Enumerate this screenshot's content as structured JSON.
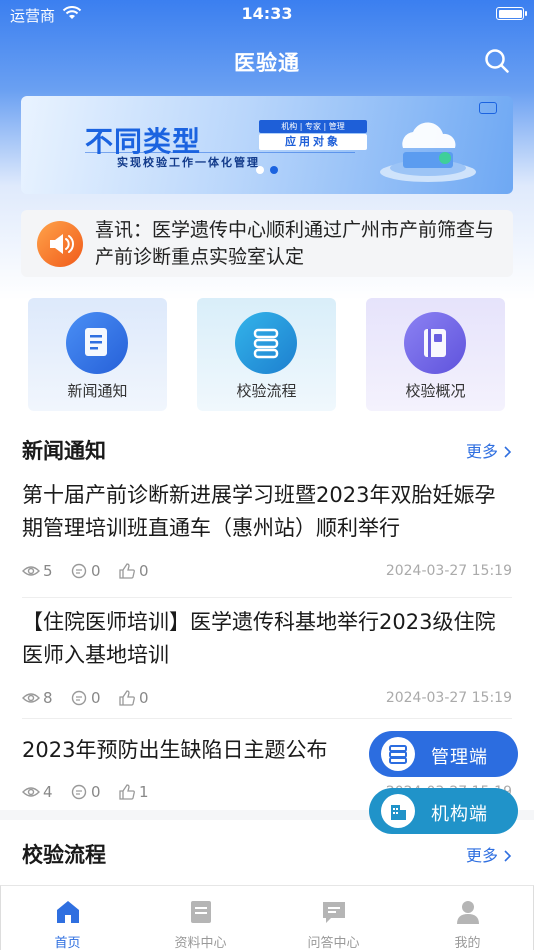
{
  "status_bar": {
    "carrier": "运营商",
    "time": "14:33"
  },
  "nav": {
    "title": "医验通"
  },
  "banner": {
    "title": "不同类型",
    "tags": "机构 | 专家 | 管理",
    "badge": "应用对象",
    "subtitle": "实现校验工作一体化管理",
    "active_index": 0,
    "dot_count": 2
  },
  "notice": {
    "text": "喜讯：医学遗传中心顺利通过广州市产前筛查与产前诊断重点实验室认定"
  },
  "quick_entries": [
    {
      "label": "新闻通知",
      "icon": "document-icon"
    },
    {
      "label": "校验流程",
      "icon": "flow-icon"
    },
    {
      "label": "校验概况",
      "icon": "book-icon"
    }
  ],
  "news_section": {
    "title": "新闻通知",
    "more": "更多",
    "items": [
      {
        "title": "第十届产前诊断新进展学习班暨2023年双胎妊娠孕期管理培训班直通车（惠州站）顺利举行",
        "views": "5",
        "comments": "0",
        "likes": "0",
        "date": "2024-03-27 15:19"
      },
      {
        "title": "【住院医师培训】医学遗传科基地举行2023级住院医师入基地培训",
        "views": "8",
        "comments": "0",
        "likes": "0",
        "date": "2024-03-27 15:19"
      },
      {
        "title": "2023年预防出生缺陷日主题公布",
        "views": "4",
        "comments": "0",
        "likes": "1",
        "date": "2024-03-27 15:19"
      }
    ]
  },
  "process_section": {
    "title": "校验流程",
    "more": "更多"
  },
  "floating": {
    "manage": "管理端",
    "org": "机构端"
  },
  "tabs": [
    {
      "label": "首页",
      "active": true
    },
    {
      "label": "资料中心",
      "active": false
    },
    {
      "label": "问答中心",
      "active": false
    },
    {
      "label": "我的",
      "active": false
    }
  ],
  "colors": {
    "primary": "#2f6fe0",
    "org_button": "#2093c9",
    "notice_icon": "#f05a1a"
  }
}
